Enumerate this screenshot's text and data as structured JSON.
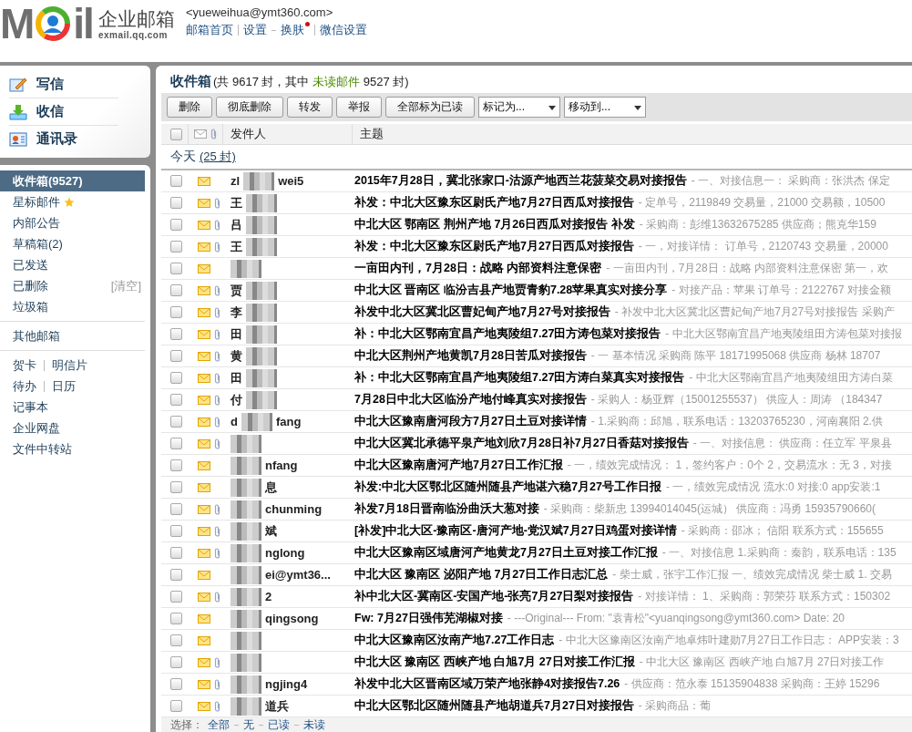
{
  "header": {
    "logo": {
      "left": "M",
      "right": "il",
      "name": "企业邮箱",
      "domain": "exmail.qq.com"
    },
    "account": "<yueweihua@ymt360.com>",
    "links": [
      {
        "kind": "first",
        "label": "邮箱首页",
        "dot": false
      },
      {
        "kind": "bar",
        "label": "设置",
        "dot": false
      },
      {
        "kind": "dash",
        "label": "换肤",
        "dot": true
      },
      {
        "kind": "bar",
        "label": "微信设置",
        "dot": false
      }
    ]
  },
  "nav": [
    {
      "label": "写信"
    },
    {
      "label": "收信"
    },
    {
      "label": "通讯录"
    }
  ],
  "folders": [
    {
      "label": "收件箱(9527)",
      "selected": true,
      "star": false
    },
    {
      "label": "星标邮件",
      "selected": false,
      "star": true
    },
    {
      "label": "内部公告",
      "selected": false,
      "star": false
    },
    {
      "label": "草稿箱(2)",
      "selected": false,
      "star": false
    },
    {
      "label": "已发送",
      "selected": false,
      "star": false
    },
    {
      "label": "已删除",
      "selected": false,
      "star": false,
      "action": "[清空]"
    },
    {
      "label": "垃圾箱",
      "selected": false,
      "star": false
    }
  ],
  "other_mailboxes": "其他邮箱",
  "tools": [
    [
      "贺卡",
      "明信片"
    ],
    [
      "待办",
      "日历"
    ],
    [
      "记事本"
    ],
    [
      "企业网盘"
    ],
    [
      "文件中转站"
    ]
  ],
  "inbox": {
    "title": "收件箱",
    "summary_start": "(共 9617 封，其中 ",
    "unread_link": "未读邮件",
    "summary_end": " 9527 封)"
  },
  "toolbar": {
    "buttons": [
      "删除",
      "彻底删除",
      "转发",
      "举报",
      "全部标为已读"
    ],
    "dropdowns": [
      "标记为...",
      "移动到..."
    ]
  },
  "columns": [
    "发件人",
    "主题"
  ],
  "select_all_checked": false,
  "group": {
    "label": "今天",
    "count": "(25 封)"
  },
  "rows": [
    {
      "sender_start": "zl",
      "sender_end": "wei5",
      "attachment": false,
      "unread": true,
      "checked": false,
      "subject": "2015年7月28日，冀北张家口-沽源产地西兰花菠菜交易对接报告",
      "snippet": "- 一、对接信息一： 采购商：张洪杰 保定"
    },
    {
      "sender_start": "王",
      "sender_end": "",
      "attachment": true,
      "unread": true,
      "checked": false,
      "subject": "补发：中北大区豫东区尉氏产地7月27日西瓜对接报告",
      "snippet": "- 定单号，2119849 交易量，21000 交易额，10500"
    },
    {
      "sender_start": "吕",
      "sender_end": "",
      "attachment": true,
      "unread": true,
      "checked": false,
      "subject": "中北大区 鄂南区 荆州产地 7月26日西瓜对接报告  补发",
      "snippet": "- 采购商：彭维13632675285 供应商；熊克华159"
    },
    {
      "sender_start": "王",
      "sender_end": "",
      "attachment": true,
      "unread": true,
      "checked": false,
      "subject": "补发：中北大区豫东区尉氏产地7月27日西瓜对接报告",
      "snippet": "- 一，对接详情： 订单号，2120743 交易量，20000"
    },
    {
      "sender_start": "",
      "sender_end": "",
      "attachment": false,
      "unread": true,
      "checked": false,
      "subject": "一亩田内刊，7月28日：战略 内部资料注意保密",
      "snippet": "- 一亩田内刊，7月28日：战略 内部资料注意保密 第一，欢"
    },
    {
      "sender_start": "贾",
      "sender_end": "",
      "attachment": true,
      "unread": true,
      "checked": false,
      "subject": "中北大区 晋南区 临汾吉县产地贾青豹7.28苹果真实对接分享",
      "snippet": "- 对接产品：苹果 订单号：2122767 对接金额"
    },
    {
      "sender_start": "李",
      "sender_end": "",
      "attachment": true,
      "unread": true,
      "checked": false,
      "subject": "补发中北大区冀北区曹妃甸产地7月27号对接报告",
      "snippet": "- 补发中北大区冀北区曹妃甸产地7月27号对接报告 采购产"
    },
    {
      "sender_start": "田",
      "sender_end": "",
      "attachment": true,
      "unread": true,
      "checked": false,
      "subject": "补：中北大区鄂南宜昌产地夷陵组7.27田方涛包菜对接报告",
      "snippet": "- 中北大区鄂南宜昌产地夷陵组田方涛包菜对接报"
    },
    {
      "sender_start": "黄",
      "sender_end": "",
      "attachment": true,
      "unread": true,
      "checked": false,
      "subject": "中北大区荆州产地黄凯7月28日苦瓜对接报告",
      "snippet": "- 一 基本情况 采购商 陈平 18171995068 供应商 杨林 18707"
    },
    {
      "sender_start": "田",
      "sender_end": "",
      "attachment": true,
      "unread": true,
      "checked": false,
      "subject": "补：中北大区鄂南宜昌产地夷陵组7.27田方涛白菜真实对接报告",
      "snippet": "- 中北大区鄂南宜昌产地夷陵组田方涛白菜"
    },
    {
      "sender_start": "付",
      "sender_end": "",
      "attachment": true,
      "unread": true,
      "checked": false,
      "subject": "7月28日中北大区临汾产地付峰真实对接报告",
      "snippet": "- 采购人：杨亚辉（15001255537） 供应人：周涛 （184347"
    },
    {
      "sender_start": "d",
      "sender_end": "fang",
      "attachment": true,
      "unread": true,
      "checked": false,
      "subject": "中北大区豫南唐河段方7月27日土豆对接详情",
      "snippet": "- 1.采购商：邱旭，联系电话：13203765230，河南襄阳 2.供"
    },
    {
      "sender_start": "",
      "sender_end": "",
      "attachment": true,
      "unread": true,
      "checked": false,
      "subject": "中北大区冀北承德平泉产地刘欣7月28日补7月27日香菇对接报告",
      "snippet": "- 一、对接信息： 供应商：任立军 平泉县"
    },
    {
      "sender_start": "",
      "sender_end": "nfang",
      "attachment": false,
      "unread": true,
      "checked": false,
      "subject": "中北大区豫南唐河产地7月27日工作汇报",
      "snippet": "- 一，绩效完成情况： 1，签约客户：0个 2，交易流水：无 3，对接"
    },
    {
      "sender_start": "",
      "sender_end": "息",
      "attachment": false,
      "unread": true,
      "checked": false,
      "subject": "补发:中北大区鄂北区随州随县产地谌六稳7月27号工作日报",
      "snippet": "- 一，绩效完成情况 流水:0 对接:0 app安装:1"
    },
    {
      "sender_start": "",
      "sender_end": "chunming",
      "attachment": true,
      "unread": true,
      "checked": false,
      "subject": "补发7月18日晋南临汾曲沃大葱对接",
      "snippet": "- 采购商：柴新忠 13994014045(运城） 供应商：冯勇 15935790660("
    },
    {
      "sender_start": "",
      "sender_end": "斌",
      "attachment": true,
      "unread": true,
      "checked": false,
      "subject": "[补发]中北大区-豫南区-唐河产地-党汉斌7月27日鸡蛋对接详情",
      "snippet": "- 采购商：邵冰； 信阳 联系方式：155655"
    },
    {
      "sender_start": "",
      "sender_end": "nglong",
      "attachment": true,
      "unread": true,
      "checked": false,
      "subject": "中北大区豫南区域唐河产地黄龙7月27日土豆对接工作汇报",
      "snippet": "- 一、对接信息 1.采购商：秦韵，联系电话：135"
    },
    {
      "sender_start": "",
      "sender_end": "ei@ymt36...",
      "attachment": false,
      "unread": true,
      "checked": false,
      "subject": "中北大区 豫南区 泌阳产地  7月27日工作日志汇总",
      "snippet": "-  柴士威，张宇工作汇报 一、绩效完成情况 柴士威 1. 交易"
    },
    {
      "sender_start": "",
      "sender_end": "2",
      "attachment": true,
      "unread": true,
      "checked": false,
      "subject": "补中北大区-冀南区-安国产地-张亮7月27日梨对接报告",
      "snippet": "- 对接详情： 1、采购商：郭荣芬 联系方式：150302"
    },
    {
      "sender_start": "",
      "sender_end": "qingsong",
      "attachment": false,
      "unread": true,
      "checked": false,
      "subject": "Fw: 7月27日强伟芜湖椒对接",
      "snippet": "- ---Original--- From: \"袁青松\"<yuanqingsong@ymt360.com> Date: 20"
    },
    {
      "sender_start": "",
      "sender_end": "",
      "attachment": false,
      "unread": true,
      "checked": false,
      "subject": "中北大区豫南区汝南产地7.27工作日志",
      "snippet": "- 中北大区豫南区汝南产地卓炜叶建勋7月27日工作日志： APP安装：3"
    },
    {
      "sender_start": "",
      "sender_end": "",
      "attachment": true,
      "unread": true,
      "checked": false,
      "subject": "中北大区  豫南区 西峡产地  白旭7月 27日对接工作汇报",
      "snippet": "- 中北大区 豫南区 西峡产地 白旭7月 27日对接工作"
    },
    {
      "sender_start": "",
      "sender_end": "ngjing4",
      "attachment": true,
      "unread": true,
      "checked": false,
      "subject": "补发中北大区晋南区域万荣产地张静4对接报告7.26",
      "snippet": "- 供应商：范永泰 15135904838 采购商：王婷 15296"
    },
    {
      "sender_start": "",
      "sender_end": "道兵",
      "attachment": true,
      "unread": true,
      "checked": false,
      "subject": "中北大区鄂北区随州随县产地胡道兵7月27日对接报告",
      "snippet": "- 采购商品：葡"
    }
  ],
  "footer": {
    "label": "选择：",
    "links": [
      "全部",
      "无",
      "已读",
      "未读"
    ]
  }
}
